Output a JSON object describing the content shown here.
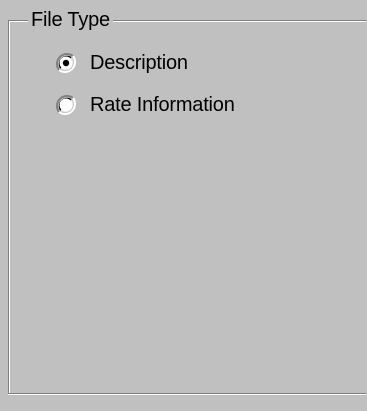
{
  "group": {
    "label": "File Type"
  },
  "options": [
    {
      "label": "Description",
      "selected": true
    },
    {
      "label": "Rate Information",
      "selected": false
    }
  ],
  "colors": {
    "face": "#c0c0c0",
    "shadow": "#808080",
    "highlight": "#ffffff",
    "dark": "#404040",
    "text": "#000000"
  }
}
